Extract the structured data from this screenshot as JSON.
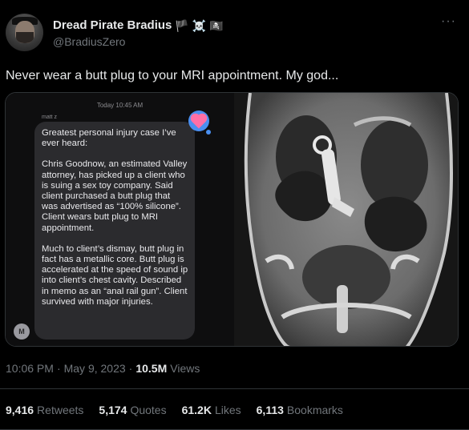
{
  "author": {
    "display_name": "Dread Pirate Bradius",
    "handle": "@BradiusZero",
    "name_emojis": [
      "🏴",
      "☠️",
      "🏴‍☠️"
    ]
  },
  "more_icon": "more-horizontal-icon",
  "tweet": {
    "text": "Never wear a butt plug to your MRI appointment. My god..."
  },
  "media": {
    "message": {
      "timestamp": "Today 10:45 AM",
      "sender": "matt z",
      "sender_initial": "M",
      "paragraphs": [
        "Greatest personal injury case I’ve ever heard:",
        "Chris Goodnow, an estimated Valley attorney, has picked up a client who is suing a sex toy company. Said client purchased a butt plug that was advertised as “100% silicone”. Client wears butt plug to MRI appointment.",
        "Much to client’s dismay, butt plug in fact has a metallic core. Butt plug is accelerated at the speed of sound ip into client’s chest cavity. Described in memo as an “anal rail gun”. Client survived with major injuries."
      ],
      "reaction": "heart"
    },
    "scan": "ct-scan-image"
  },
  "meta": {
    "time": "10:06 PM",
    "date": "May 9, 2023",
    "views_count": "10.5M",
    "views_label": "Views"
  },
  "stats": {
    "retweets": {
      "count": "9,416",
      "label": "Retweets"
    },
    "quotes": {
      "count": "5,174",
      "label": "Quotes"
    },
    "likes": {
      "count": "61.2K",
      "label": "Likes"
    },
    "bookmarks": {
      "count": "6,113",
      "label": "Bookmarks"
    }
  },
  "colors": {
    "background": "#000000",
    "text_primary": "#e7e9ea",
    "text_secondary": "#71767b",
    "divider": "#2f3336"
  }
}
